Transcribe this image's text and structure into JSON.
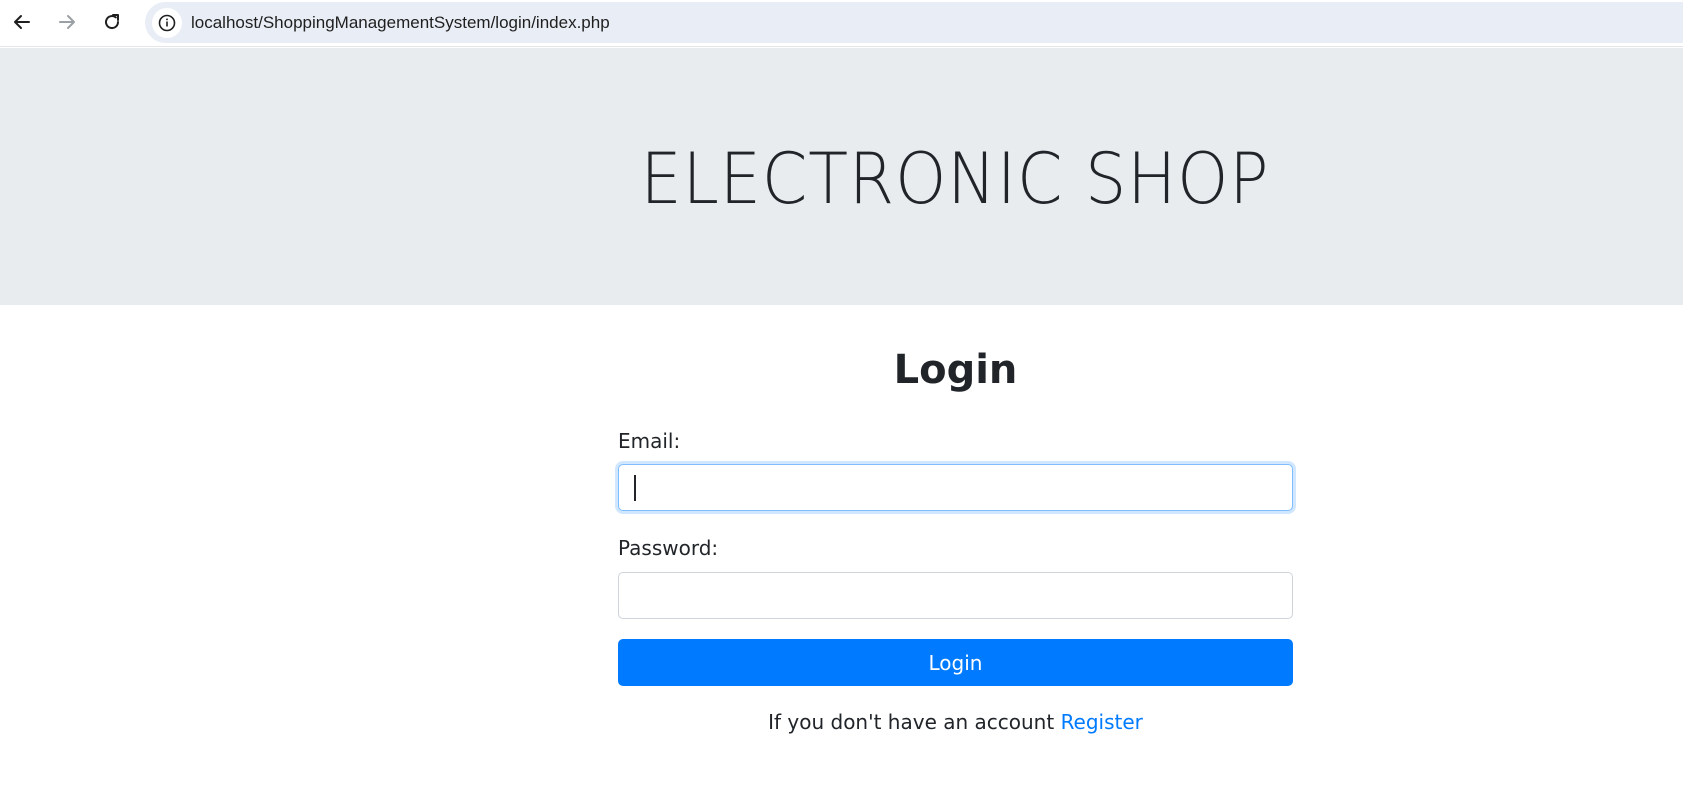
{
  "browser": {
    "url": "localhost/ShoppingManagementSystem/login/index.php",
    "icons": {
      "back": "arrow-left-icon",
      "forward": "arrow-right-icon",
      "reload": "reload-icon",
      "site_info": "info-icon"
    }
  },
  "header": {
    "title": "ELECTRONIC SHOP"
  },
  "login_form": {
    "heading": "Login",
    "email_label": "Email:",
    "email_value": "",
    "password_label": "Password:",
    "password_value": "",
    "submit_label": "Login",
    "register_prompt": "If you don't have an account",
    "register_link": "Register"
  },
  "colors": {
    "primary": "#007bff",
    "header_bg": "#e9ecef",
    "address_bar_bg": "#e9edf6",
    "text": "#212529"
  }
}
